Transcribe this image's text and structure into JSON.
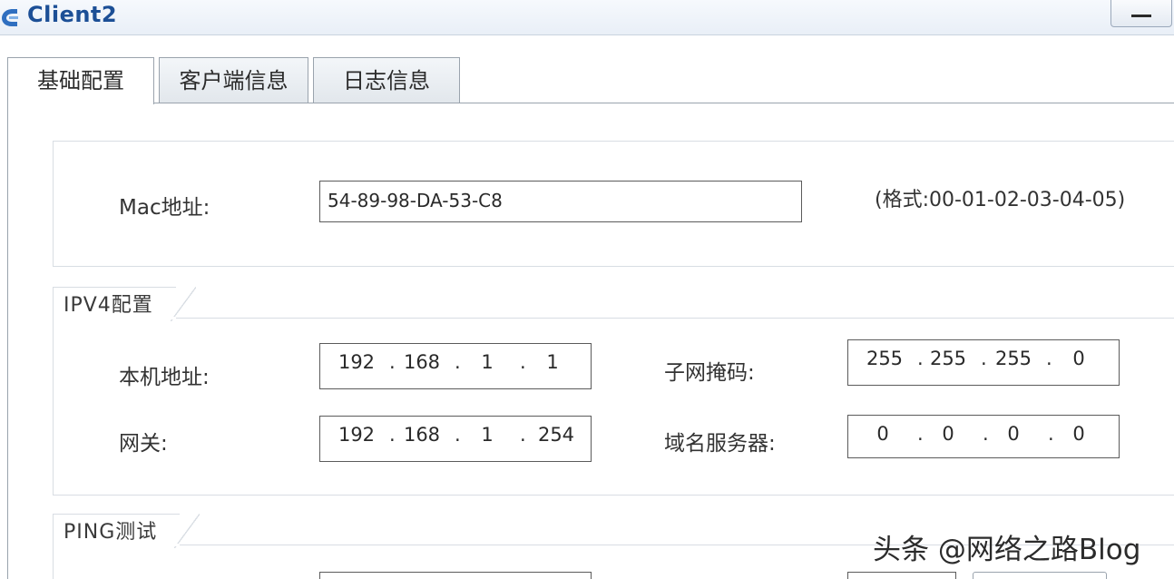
{
  "window": {
    "title": "Client2"
  },
  "tabs": [
    {
      "label": "基础配置",
      "active": true
    },
    {
      "label": "客户端信息",
      "active": false
    },
    {
      "label": "日志信息",
      "active": false
    }
  ],
  "mac": {
    "label": "Mac地址:",
    "value": "54-89-98-DA-53-C8",
    "format_hint": "(格式:00-01-02-03-04-05)"
  },
  "ipv4": {
    "section_title": "IPV4配置",
    "local_address": {
      "label": "本机地址:",
      "octets": [
        "192",
        "168",
        "1",
        "1"
      ]
    },
    "subnet_mask": {
      "label": "子网掩码:",
      "octets": [
        "255",
        "255",
        "255",
        "0"
      ]
    },
    "gateway": {
      "label": "网关:",
      "octets": [
        "192",
        "168",
        "1",
        "254"
      ]
    },
    "dns_server": {
      "label": "域名服务器:",
      "octets": [
        "0",
        "0",
        "0",
        "0"
      ]
    }
  },
  "ping": {
    "section_title": "PING测试"
  },
  "watermark": "头条 @网络之路Blog",
  "colors": {
    "title_text": "#1c4f96",
    "border": "#5b5b5b"
  }
}
